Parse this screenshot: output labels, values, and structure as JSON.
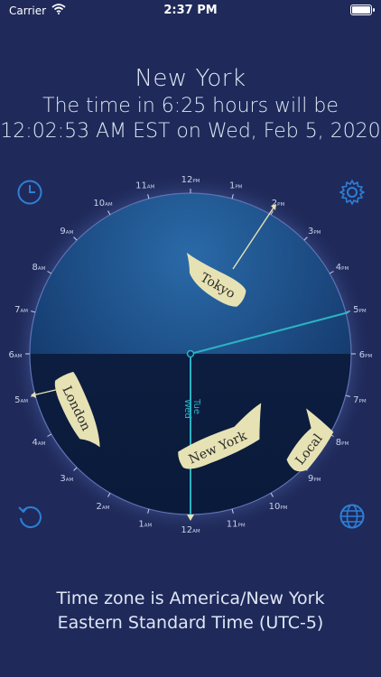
{
  "status_bar": {
    "carrier": "Carrier",
    "time": "2:37 PM"
  },
  "header": {
    "city": "New York",
    "line1": "The time in 6:25 hours will be",
    "line2": "12:02:53 AM EST on Wed, Feb 5, 2020"
  },
  "dial": {
    "hours": [
      {
        "n": "12",
        "p": "PM"
      },
      {
        "n": "1",
        "p": "PM"
      },
      {
        "n": "2",
        "p": "PM"
      },
      {
        "n": "3",
        "p": "PM"
      },
      {
        "n": "4",
        "p": "PM"
      },
      {
        "n": "5",
        "p": "PM"
      },
      {
        "n": "6",
        "p": "PM"
      },
      {
        "n": "7",
        "p": "PM"
      },
      {
        "n": "8",
        "p": "PM"
      },
      {
        "n": "9",
        "p": "PM"
      },
      {
        "n": "10",
        "p": "PM"
      },
      {
        "n": "11",
        "p": "PM"
      },
      {
        "n": "12",
        "p": "AM"
      },
      {
        "n": "1",
        "p": "AM"
      },
      {
        "n": "2",
        "p": "AM"
      },
      {
        "n": "3",
        "p": "AM"
      },
      {
        "n": "4",
        "p": "AM"
      },
      {
        "n": "5",
        "p": "AM"
      },
      {
        "n": "6",
        "p": "AM"
      },
      {
        "n": "7",
        "p": "AM"
      },
      {
        "n": "8",
        "p": "AM"
      },
      {
        "n": "9",
        "p": "AM"
      },
      {
        "n": "10",
        "p": "AM"
      },
      {
        "n": "11",
        "p": "AM"
      }
    ],
    "day_before": "Wed",
    "day_after": "Tue",
    "flags": [
      "Tokyo",
      "London",
      "New York",
      "Local"
    ]
  },
  "footer": {
    "line1": "Time zone is America/New York",
    "line2": "Eastern Standard Time (UTC-5)"
  },
  "colors": {
    "background": "#1f2a5a",
    "accent": "#2e7fd6",
    "flag": "#e6e2b4",
    "hand": "#2bb3c4"
  },
  "icons": [
    "clock-icon",
    "settings-gear-icon",
    "reset-icon",
    "globe-icon"
  ]
}
